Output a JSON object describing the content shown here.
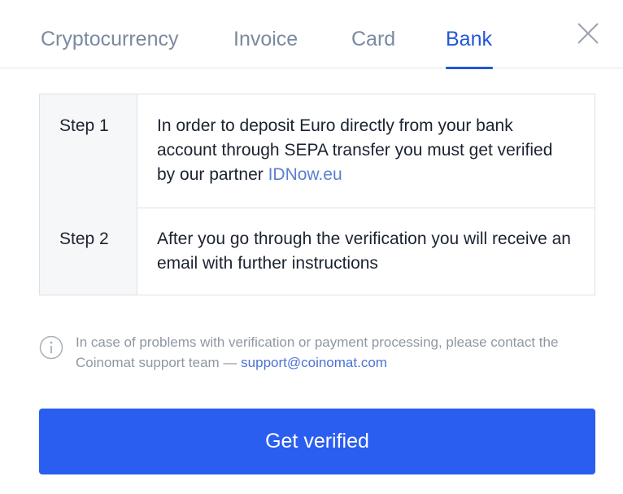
{
  "tabs": [
    {
      "label": "Cryptocurrency",
      "active": false
    },
    {
      "label": "Invoice",
      "active": false
    },
    {
      "label": "Card",
      "active": false
    },
    {
      "label": "Bank",
      "active": true
    }
  ],
  "close": {
    "icon": "close-icon"
  },
  "steps": [
    {
      "label": "Step 1",
      "text": "In order to deposit Euro directly from your bank account through SEPA transfer you must get verified by our partner ",
      "link": "IDNow.eu"
    },
    {
      "label": "Step 2",
      "text": "After you go through the verification you will receive an email with further instructions"
    }
  ],
  "info": {
    "icon": "info-icon",
    "text": "In case of problems with verification or payment processing, please contact the Coinomat support team — ",
    "email": "support@coinomat.com"
  },
  "cta": {
    "label": "Get verified"
  },
  "colors": {
    "accent": "#2456d8",
    "button": "#2a5ef0",
    "link": "#5b7fd0",
    "muted_text": "#8e97a3",
    "inactive_tab": "#7a8aa0"
  }
}
